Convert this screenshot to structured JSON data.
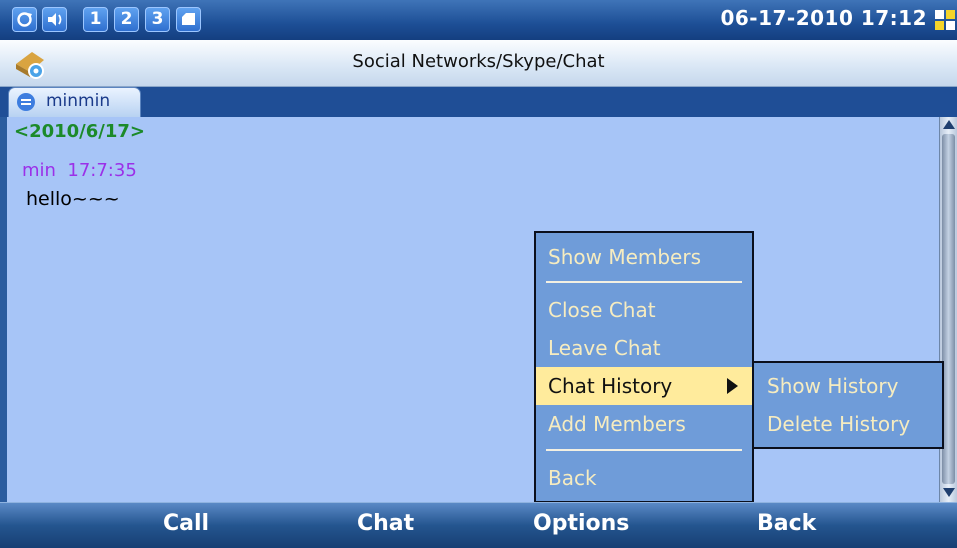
{
  "status_bar": {
    "indicators": [
      "sync-icon",
      "volume-icon"
    ],
    "line_numbers": [
      "1",
      "2",
      "3"
    ],
    "extra_icon": "folder-icon",
    "datetime": "06-17-2010 17:12"
  },
  "title_bar": {
    "title": "Social Networks/Skype/Chat"
  },
  "tab": {
    "label": "minmin"
  },
  "chat": {
    "date_header": "<2010/6/17>",
    "sender_line": "min  17:7:35",
    "message": "hello~~~"
  },
  "menu": {
    "items": [
      "Show Members",
      "Close Chat",
      "Leave Chat",
      "Chat History",
      "Add Members",
      "Back"
    ],
    "selected": "Chat History"
  },
  "submenu": {
    "items": [
      "Show History",
      "Delete History"
    ]
  },
  "softkeys": {
    "left": "Call",
    "center_left": "Chat",
    "center_right": "Options",
    "right": "Back"
  },
  "colors": {
    "background": "#a7c5f7",
    "menu_bg": "#6f9cd9",
    "menu_highlight": "#ffeb9c",
    "menu_text": "#f6ecc0",
    "date_green": "#1c8a2a",
    "sender_purple": "#9b30e8"
  }
}
